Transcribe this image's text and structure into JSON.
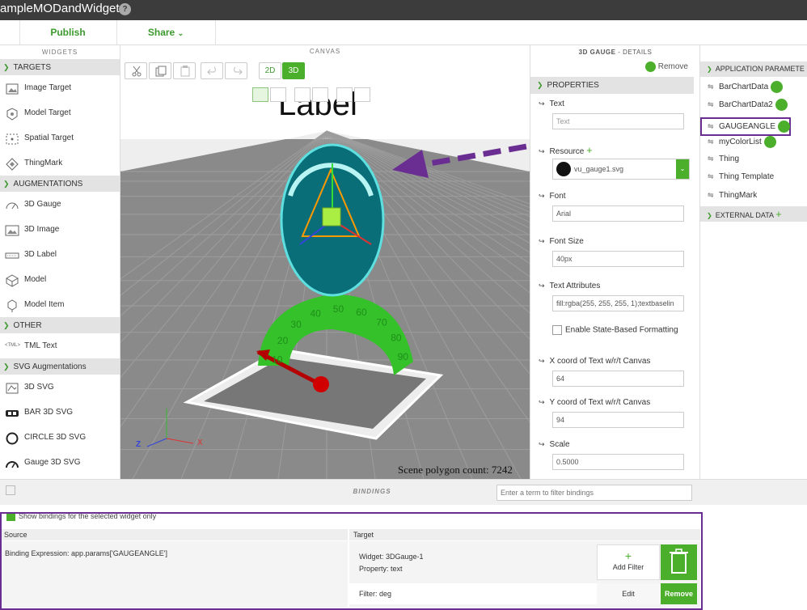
{
  "app": {
    "title": "ampleMODandWidget",
    "help": "?"
  },
  "toolbar": {
    "publish": "Publish",
    "share": "Share"
  },
  "widgets": {
    "header": "WIDGETS",
    "sections": [
      {
        "label": "TARGETS",
        "items": [
          "Image Target",
          "Model Target",
          "Spatial Target",
          "ThingMark"
        ]
      },
      {
        "label": "AUGMENTATIONS",
        "items": [
          "3D Gauge",
          "3D Image",
          "3D Label",
          "Model",
          "Model Item"
        ]
      },
      {
        "label": "OTHER",
        "items": [
          "TML Text"
        ]
      },
      {
        "label": "SVG Augmentations",
        "items": [
          "3D SVG",
          "BAR 3D SVG",
          "CIRCLE 3D SVG",
          "Gauge 3D SVG"
        ]
      }
    ]
  },
  "canvas": {
    "header": "CANVAS",
    "mode_2d": "2D",
    "mode_3d": "3D",
    "scene_label": "Label",
    "polygon_count": "Scene polygon count: 7242",
    "gauge_numbers": [
      "10",
      "20",
      "30",
      "40",
      "50",
      "60",
      "70",
      "80",
      "90"
    ],
    "axis_z": "Z",
    "axis_x": "X"
  },
  "details": {
    "title": "3D GAUGE",
    "title_suffix": " - DETAILS",
    "remove": "Remove",
    "properties": "PROPERTIES",
    "text_label": "Text",
    "text_value": "Text",
    "resource_label": "Resource",
    "resource_value": "vu_gauge1.svg",
    "font_label": "Font",
    "font_value": "Arial",
    "font_size_label": "Font Size",
    "font_size_value": "40px",
    "text_attr_label": "Text Attributes",
    "text_attr_value": "fill:rgba(255, 255, 255, 1);textbaselin",
    "state_based": "Enable State-Based Formatting",
    "x_label": "X coord of Text w/r/t Canvas",
    "x_value": "64",
    "y_label": "Y coord of Text w/r/t Canvas",
    "y_value": "94",
    "scale_label": "Scale",
    "scale_value": "0.5000"
  },
  "params": {
    "header": "APPLICATION PARAMETE",
    "items": [
      "BarChartData",
      "BarChartData2",
      "GAUGEANGLE",
      "myColorList",
      "Thing",
      "Thing Template",
      "ThingMark"
    ],
    "external": "EXTERNAL DATA"
  },
  "bindings": {
    "title": "BINDINGS",
    "filter_placeholder": "Enter a term to filter bindings",
    "show_selected": "Show bindings for the selected widget only",
    "source_header": "Source",
    "target_header": "Target",
    "expression_label": "Binding Expression:",
    "expression_value": " app.params['GAUGEANGLE']",
    "widget_label": "Widget:",
    "widget_value": " 3DGauge-1",
    "property_label": "Property:",
    "property_value": " text",
    "add_filter": "Add Filter",
    "filter_label": "Filter:",
    "filter_value": " deg",
    "edit": "Edit",
    "remove": "Remove"
  }
}
